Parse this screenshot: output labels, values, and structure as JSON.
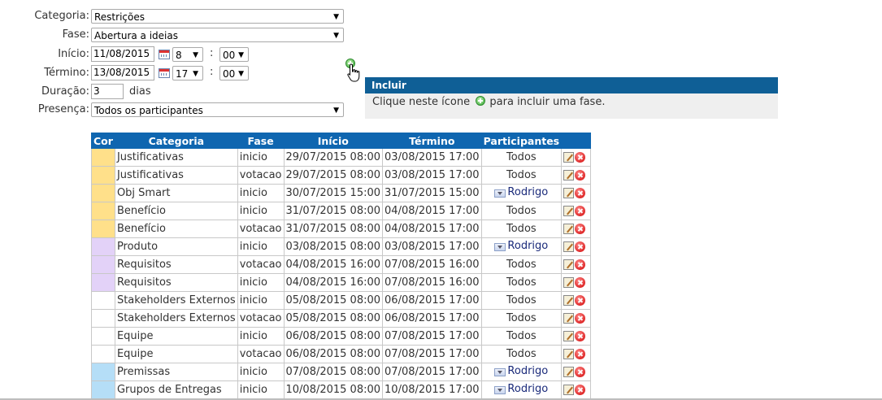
{
  "form": {
    "categoria_label": "Categoria:",
    "categoria_value": "Restrições",
    "fase_label": "Fase:",
    "fase_value": "Abertura a ideias",
    "inicio_label": "Início:",
    "inicio_date": "11/08/2015",
    "inicio_hour": "8",
    "inicio_min": "00",
    "termino_label": "Término:",
    "termino_date": "13/08/2015",
    "termino_hour": "17",
    "termino_min": "00",
    "colon": ":",
    "duracao_label": "Duração:",
    "duracao_value": "3",
    "duracao_unit": "dias",
    "presenca_label": "Presença:",
    "presenca_value": "Todos os participantes"
  },
  "tooltip": {
    "title": "Incluir",
    "body_before": "Clique neste ícone",
    "body_after": "para incluir uma fase."
  },
  "table": {
    "headers": [
      "Cor",
      "Categoria",
      "Fase",
      "Início",
      "Término",
      "Participantes"
    ],
    "rows": [
      {
        "color": "#ffe08a",
        "categoria": "Justificativas",
        "fase": "inicio",
        "inicio": "29/07/2015 08:00",
        "termino": "03/08/2015 17:00",
        "participantes": "Todos",
        "dropdown": false
      },
      {
        "color": "#ffe08a",
        "categoria": "Justificativas",
        "fase": "votacao",
        "inicio": "29/07/2015 08:00",
        "termino": "03/08/2015 17:00",
        "participantes": "Todos",
        "dropdown": false
      },
      {
        "color": "#ffe08a",
        "categoria": "Obj Smart",
        "fase": "inicio",
        "inicio": "30/07/2015 15:00",
        "termino": "31/07/2015 15:00",
        "participantes": "Rodrigo",
        "dropdown": true
      },
      {
        "color": "#ffe08a",
        "categoria": "Benefício",
        "fase": "inicio",
        "inicio": "31/07/2015 08:00",
        "termino": "04/08/2015 17:00",
        "participantes": "Todos",
        "dropdown": false
      },
      {
        "color": "#ffe08a",
        "categoria": "Benefício",
        "fase": "votacao",
        "inicio": "31/07/2015 08:00",
        "termino": "04/08/2015 17:00",
        "participantes": "Todos",
        "dropdown": false
      },
      {
        "color": "#e3d2f8",
        "categoria": "Produto",
        "fase": "inicio",
        "inicio": "03/08/2015 08:00",
        "termino": "03/08/2015 17:00",
        "participantes": "Rodrigo",
        "dropdown": true
      },
      {
        "color": "#e3d2f8",
        "categoria": "Requisitos",
        "fase": "votacao",
        "inicio": "04/08/2015 16:00",
        "termino": "07/08/2015 16:00",
        "participantes": "Todos",
        "dropdown": false
      },
      {
        "color": "#e3d2f8",
        "categoria": "Requisitos",
        "fase": "inicio",
        "inicio": "04/08/2015 16:00",
        "termino": "07/08/2015 16:00",
        "participantes": "Todos",
        "dropdown": false
      },
      {
        "color": "#ffffff",
        "categoria": "Stakeholders Externos",
        "fase": "inicio",
        "inicio": "05/08/2015 08:00",
        "termino": "06/08/2015 17:00",
        "participantes": "Todos",
        "dropdown": false
      },
      {
        "color": "#ffffff",
        "categoria": "Stakeholders Externos",
        "fase": "votacao",
        "inicio": "05/08/2015 08:00",
        "termino": "06/08/2015 17:00",
        "participantes": "Todos",
        "dropdown": false
      },
      {
        "color": "#ffffff",
        "categoria": "Equipe",
        "fase": "inicio",
        "inicio": "06/08/2015 08:00",
        "termino": "07/08/2015 17:00",
        "participantes": "Todos",
        "dropdown": false
      },
      {
        "color": "#ffffff",
        "categoria": "Equipe",
        "fase": "votacao",
        "inicio": "06/08/2015 08:00",
        "termino": "07/08/2015 17:00",
        "participantes": "Todos",
        "dropdown": false
      },
      {
        "color": "#b5def7",
        "categoria": "Premissas",
        "fase": "inicio",
        "inicio": "07/08/2015 08:00",
        "termino": "07/08/2015 17:00",
        "participantes": "Rodrigo",
        "dropdown": true
      },
      {
        "color": "#b5def7",
        "categoria": "Grupos de Entregas",
        "fase": "inicio",
        "inicio": "10/08/2015 08:00",
        "termino": "10/08/2015 17:00",
        "participantes": "Rodrigo",
        "dropdown": true
      }
    ]
  }
}
